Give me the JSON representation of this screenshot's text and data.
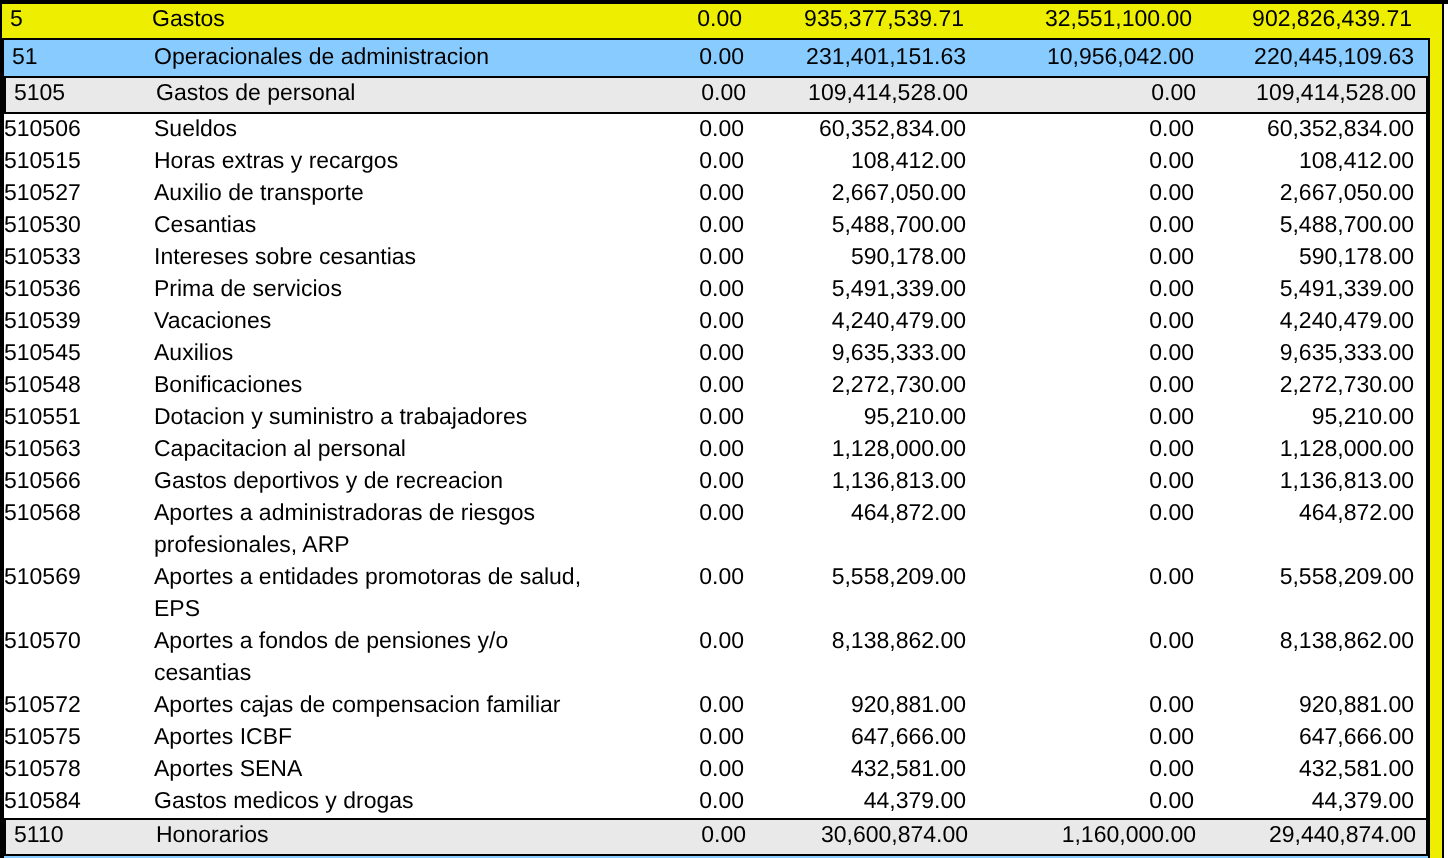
{
  "groups": [
    {
      "code": "5",
      "name": "Gastos",
      "values": [
        "0.00",
        "935,377,539.71",
        "32,551,100.00",
        "902,826,439.71"
      ],
      "children": [
        {
          "code": "51",
          "name": "Operacionales de administracion",
          "values": [
            "0.00",
            "231,401,151.63",
            "10,956,042.00",
            "220,445,109.63"
          ],
          "children": [
            {
              "code": "5105",
              "name": "Gastos de personal",
              "values": [
                "0.00",
                "109,414,528.00",
                "0.00",
                "109,414,528.00"
              ],
              "children": [
                {
                  "code": "510506",
                  "name": "Sueldos",
                  "values": [
                    "0.00",
                    "60,352,834.00",
                    "0.00",
                    "60,352,834.00"
                  ]
                },
                {
                  "code": "510515",
                  "name": "Horas extras y recargos",
                  "values": [
                    "0.00",
                    "108,412.00",
                    "0.00",
                    "108,412.00"
                  ]
                },
                {
                  "code": "510527",
                  "name": "Auxilio de transporte",
                  "values": [
                    "0.00",
                    "2,667,050.00",
                    "0.00",
                    "2,667,050.00"
                  ]
                },
                {
                  "code": "510530",
                  "name": "Cesantias",
                  "values": [
                    "0.00",
                    "5,488,700.00",
                    "0.00",
                    "5,488,700.00"
                  ]
                },
                {
                  "code": "510533",
                  "name": "Intereses sobre cesantias",
                  "values": [
                    "0.00",
                    "590,178.00",
                    "0.00",
                    "590,178.00"
                  ]
                },
                {
                  "code": "510536",
                  "name": "Prima de servicios",
                  "values": [
                    "0.00",
                    "5,491,339.00",
                    "0.00",
                    "5,491,339.00"
                  ]
                },
                {
                  "code": "510539",
                  "name": "Vacaciones",
                  "values": [
                    "0.00",
                    "4,240,479.00",
                    "0.00",
                    "4,240,479.00"
                  ]
                },
                {
                  "code": "510545",
                  "name": "Auxilios",
                  "values": [
                    "0.00",
                    "9,635,333.00",
                    "0.00",
                    "9,635,333.00"
                  ]
                },
                {
                  "code": "510548",
                  "name": "Bonificaciones",
                  "values": [
                    "0.00",
                    "2,272,730.00",
                    "0.00",
                    "2,272,730.00"
                  ]
                },
                {
                  "code": "510551",
                  "name": "Dotacion y suministro a trabajadores",
                  "values": [
                    "0.00",
                    "95,210.00",
                    "0.00",
                    "95,210.00"
                  ]
                },
                {
                  "code": "510563",
                  "name": "Capacitacion al personal",
                  "values": [
                    "0.00",
                    "1,128,000.00",
                    "0.00",
                    "1,128,000.00"
                  ]
                },
                {
                  "code": "510566",
                  "name": "Gastos deportivos y de recreacion",
                  "values": [
                    "0.00",
                    "1,136,813.00",
                    "0.00",
                    "1,136,813.00"
                  ]
                },
                {
                  "code": "510568",
                  "name": "Aportes a administradoras de riesgos profesionales, ARP",
                  "values": [
                    "0.00",
                    "464,872.00",
                    "0.00",
                    "464,872.00"
                  ]
                },
                {
                  "code": "510569",
                  "name": "Aportes a entidades promotoras de salud, EPS",
                  "values": [
                    "0.00",
                    "5,558,209.00",
                    "0.00",
                    "5,558,209.00"
                  ]
                },
                {
                  "code": "510570",
                  "name": "Aportes a fondos de pensiones y/o cesantias",
                  "values": [
                    "0.00",
                    "8,138,862.00",
                    "0.00",
                    "8,138,862.00"
                  ]
                },
                {
                  "code": "510572",
                  "name": "Aportes cajas de compensacion familiar",
                  "values": [
                    "0.00",
                    "920,881.00",
                    "0.00",
                    "920,881.00"
                  ]
                },
                {
                  "code": "510575",
                  "name": "Aportes ICBF",
                  "values": [
                    "0.00",
                    "647,666.00",
                    "0.00",
                    "647,666.00"
                  ]
                },
                {
                  "code": "510578",
                  "name": "Aportes SENA",
                  "values": [
                    "0.00",
                    "432,581.00",
                    "0.00",
                    "432,581.00"
                  ]
                },
                {
                  "code": "510584",
                  "name": "Gastos medicos y drogas",
                  "values": [
                    "0.00",
                    "44,379.00",
                    "0.00",
                    "44,379.00"
                  ]
                }
              ]
            },
            {
              "code": "5110",
              "name": "Honorarios",
              "values": [
                "0.00",
                "30,600,874.00",
                "1,160,000.00",
                "29,440,874.00"
              ]
            }
          ]
        }
      ]
    }
  ]
}
